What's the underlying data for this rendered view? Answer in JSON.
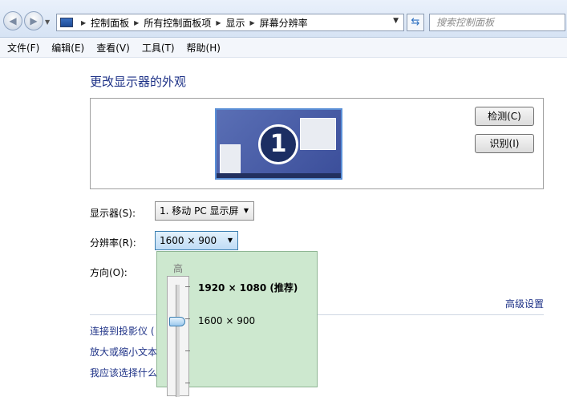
{
  "address": {
    "breadcrumbs": [
      "控制面板",
      "所有控制面板项",
      "显示",
      "屏幕分辨率"
    ],
    "search_placeholder": "搜索控制面板"
  },
  "menu": [
    "文件(F)",
    "编辑(E)",
    "查看(V)",
    "工具(T)",
    "帮助(H)"
  ],
  "page": {
    "title": "更改显示器的外观",
    "monitor_number": "1",
    "detect_button": "检测(C)",
    "identify_button": "识别(I)",
    "display_label": "显示器(S):",
    "display_value": "1. 移动 PC 显示屏",
    "resolution_label": "分辨率(R):",
    "resolution_value": "1600 × 900",
    "orientation_label": "方向(O):",
    "advanced_link": "高级设置",
    "links": [
      "连接到投影仪 (",
      "放大或缩小文本",
      "我应该选择什么"
    ]
  },
  "resolution_popup": {
    "high_label": "高",
    "options": [
      "1920 × 1080 (推荐)",
      "1600 × 900"
    ],
    "selected": "1600 × 900"
  },
  "colors": {
    "accent_link": "#1e3287",
    "popup_bg": "#cde8cf"
  }
}
